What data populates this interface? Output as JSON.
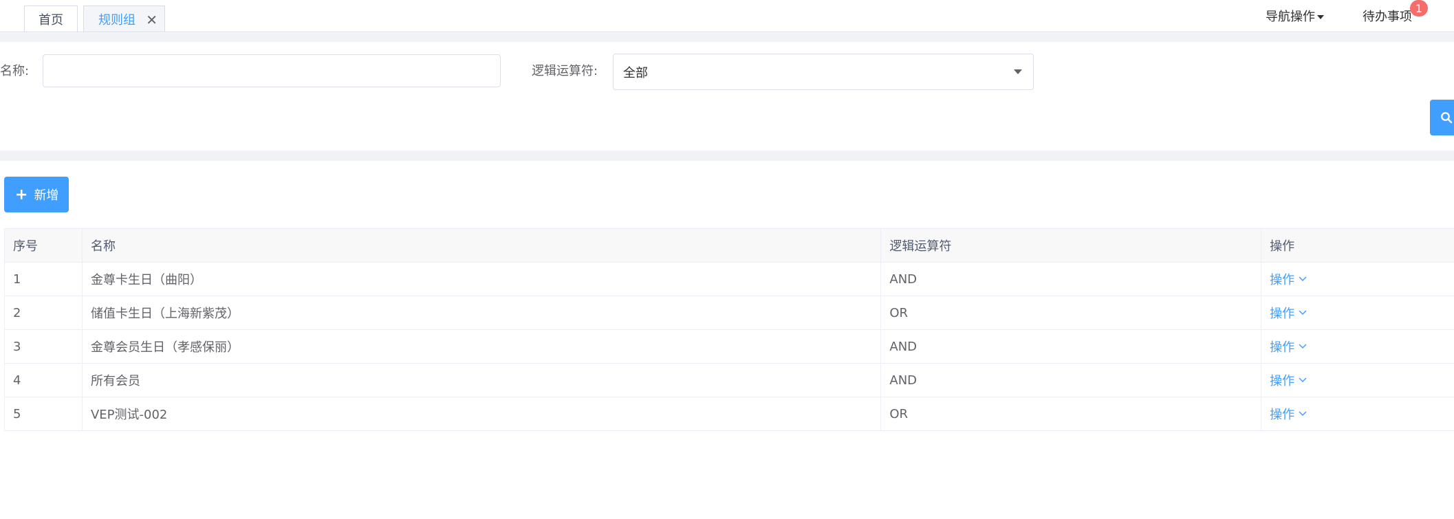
{
  "tabs": [
    {
      "label": "首页"
    },
    {
      "label": "规则组"
    }
  ],
  "header": {
    "nav_ops": "导航操作",
    "todo": "待办事项",
    "todo_badge": "1"
  },
  "filters": {
    "name_label": "名称:",
    "name_value": "",
    "logic_label": "逻辑运算符:",
    "logic_value": "全部"
  },
  "toolbar": {
    "add_label": "新增"
  },
  "table": {
    "columns": [
      "序号",
      "名称",
      "逻辑运算符",
      "操作"
    ],
    "rows": [
      {
        "index": "1",
        "name": "金尊卡生日（曲阳）",
        "logic": "AND",
        "action": "操作"
      },
      {
        "index": "2",
        "name": "储值卡生日（上海新紫茂）",
        "logic": "OR",
        "action": "操作"
      },
      {
        "index": "3",
        "name": "金尊会员生日（孝感保丽）",
        "logic": "AND",
        "action": "操作"
      },
      {
        "index": "4",
        "name": "所有会员",
        "logic": "AND",
        "action": "操作"
      },
      {
        "index": "5",
        "name": "VEP测试-002",
        "logic": "OR",
        "action": "操作"
      }
    ]
  },
  "colors": {
    "accent": "#409eff",
    "badge": "#f56c6c",
    "background_gap": "#f0f2f5"
  }
}
